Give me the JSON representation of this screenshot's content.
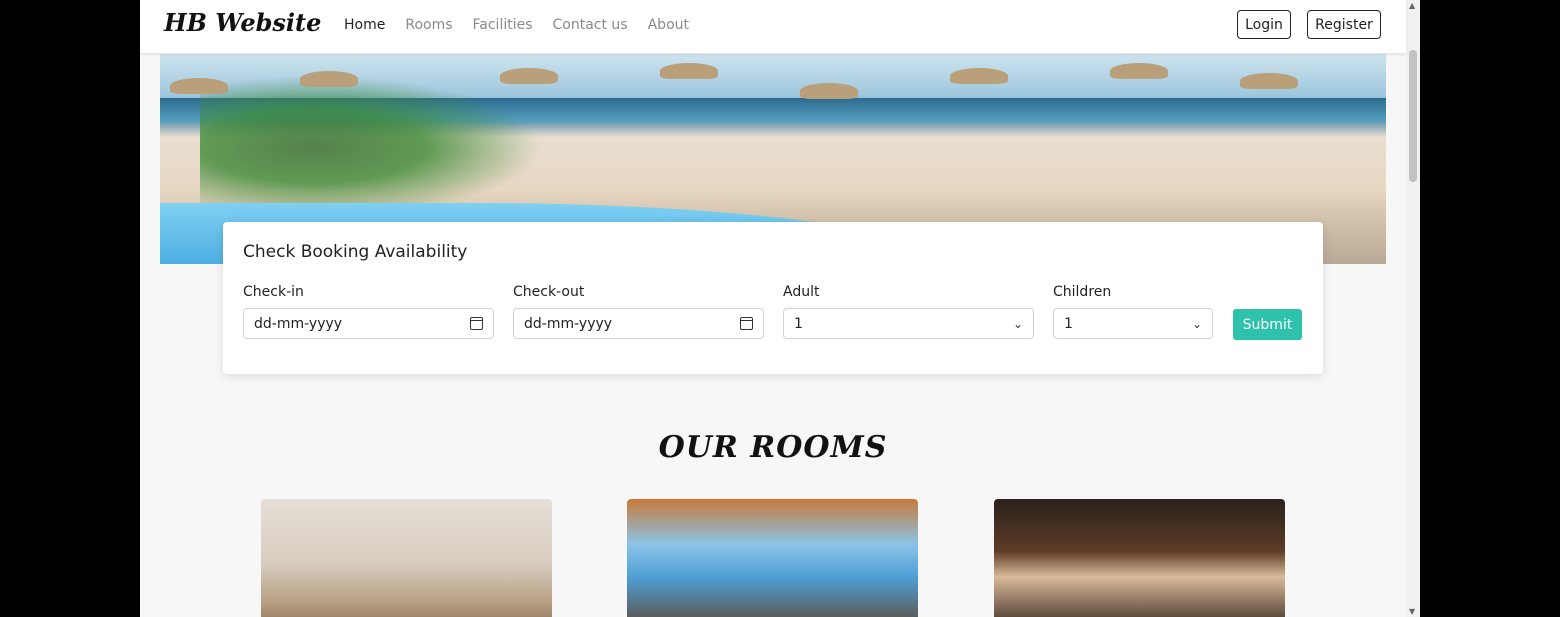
{
  "brand": "HB Website",
  "nav": {
    "home": "Home",
    "rooms": "Rooms",
    "facilities": "Facilities",
    "contact": "Contact us",
    "about": "About"
  },
  "auth": {
    "login": "Login",
    "register": "Register"
  },
  "booking": {
    "title": "Check Booking Availability",
    "checkin_label": "Check-in",
    "checkin_value": "dd-mm-yyyy",
    "checkout_label": "Check-out",
    "checkout_value": "dd-mm-yyyy",
    "adult_label": "Adult",
    "adult_value": "1",
    "children_label": "Children",
    "children_value": "1",
    "submit": "Submit"
  },
  "rooms_section": {
    "title": "OUR ROOMS"
  },
  "colors": {
    "accent": "#2ec1ac",
    "text": "#222222",
    "muted": "#8a8a8a"
  },
  "icons": [
    "calendar-icon",
    "chevron-down-icon",
    "scroll-up-arrow-icon",
    "scroll-down-arrow-icon"
  ]
}
